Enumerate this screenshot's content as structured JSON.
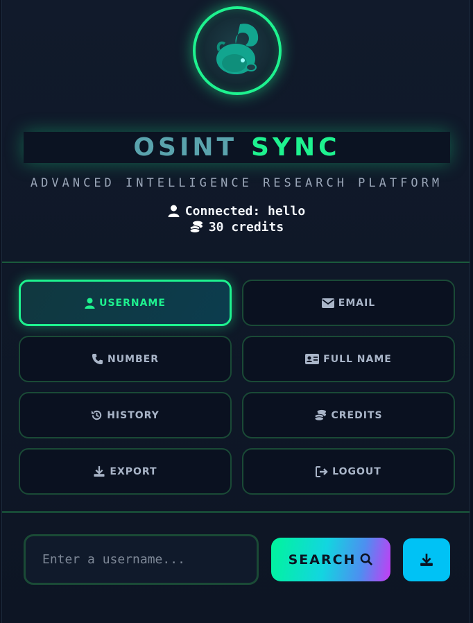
{
  "header": {
    "title_part1": "OSINT",
    "title_part2": "SYNC",
    "subtitle": "ADVANCED INTELLIGENCE RESEARCH PLATFORM",
    "connected_text": "Connected: hello",
    "credits_text": "30 credits"
  },
  "menu": [
    {
      "label": "USERNAME",
      "icon": "user-icon",
      "active": true
    },
    {
      "label": "EMAIL",
      "icon": "envelope-icon",
      "active": false
    },
    {
      "label": "NUMBER",
      "icon": "phone-icon",
      "active": false
    },
    {
      "label": "FULL NAME",
      "icon": "id-card-icon",
      "active": false
    },
    {
      "label": "HISTORY",
      "icon": "history-icon",
      "active": false
    },
    {
      "label": "CREDITS",
      "icon": "coins-icon",
      "active": false
    },
    {
      "label": "EXPORT",
      "icon": "download-icon",
      "active": false
    },
    {
      "label": "LOGOUT",
      "icon": "logout-icon",
      "active": false
    }
  ],
  "search": {
    "placeholder": "Enter a username...",
    "value": "",
    "button_label": "SEARCH"
  },
  "colors": {
    "accent": "#1ef28f",
    "background": "#0b1120",
    "download_button": "#00c2f5"
  }
}
